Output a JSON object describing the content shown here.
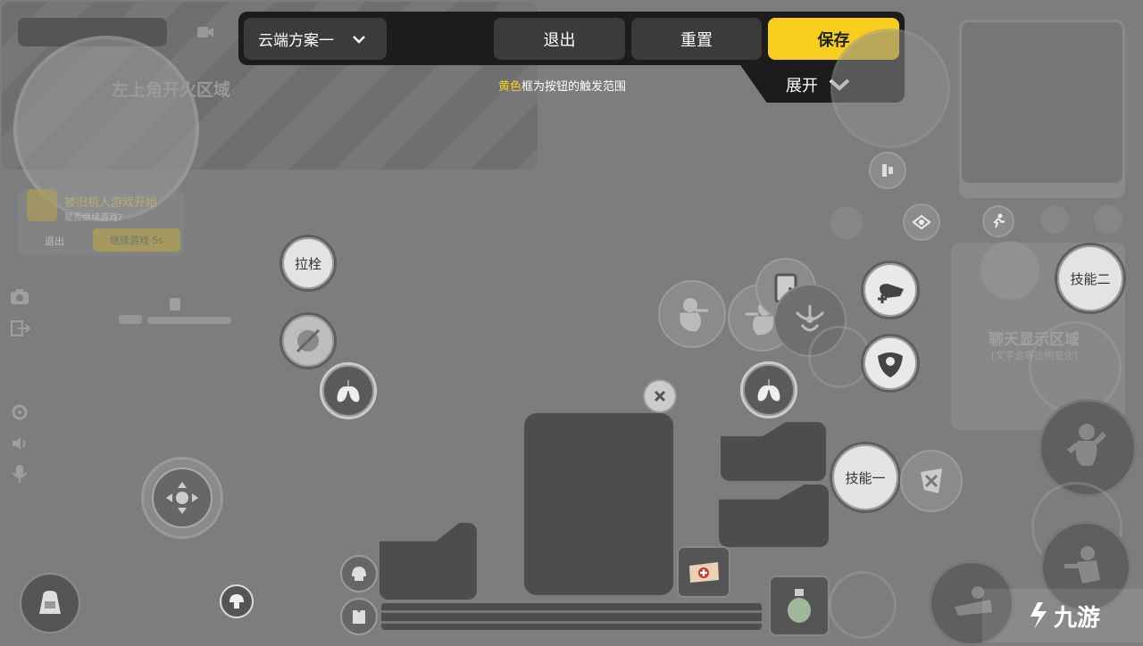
{
  "toolbar": {
    "scheme_name": "云端方案一",
    "exit_label": "退出",
    "reset_label": "重置",
    "save_label": "保存",
    "hint_highlight": "黄色",
    "hint_rest": "框为按钮的触发范围",
    "expand_label": "展开"
  },
  "zones": {
    "fire_zone_label": "左上角开火区域",
    "chat_zone_label": "聊天显示区域",
    "chat_zone_sub": "[文字会等比例变化]"
  },
  "notice": {
    "title": "被旧机人游戏开始",
    "subtitle": "是否继续游戏?",
    "exit_label": "退出",
    "continue_label": "继续游戏  5s"
  },
  "buttons": {
    "bolt_label": "拉栓",
    "skill_two_label": "技能二",
    "skill_one_label": "技能一"
  },
  "watermark": {
    "text": "九游"
  },
  "colors": {
    "accent": "#f7ce1d",
    "toolbar_bg": "#1c1c1c",
    "screen_bg": "#7d7d7d"
  }
}
